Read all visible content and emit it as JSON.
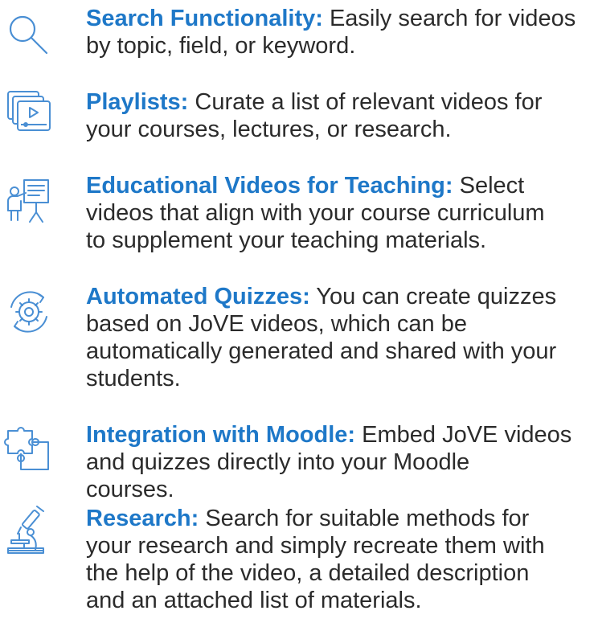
{
  "accent_color": "#1e78c8",
  "icon_color": "#4a8fd4",
  "text_color": "#2b2b2b",
  "features": [
    {
      "icon": "search-icon",
      "title": "Search Functionality:",
      "line1": "Easily search for videos",
      "lines": [
        "by topic, field, or keyword."
      ]
    },
    {
      "icon": "playlist-icon",
      "title": "Playlists:",
      "line1": "Curate a list of relevant videos for",
      "lines": [
        "your courses, lectures, or research."
      ]
    },
    {
      "icon": "teacher-presentation-icon",
      "title": "Educational Videos for Teaching:",
      "line1": "Select",
      "lines": [
        "videos that align with your course curriculum",
        "to supplement your teaching materials."
      ]
    },
    {
      "icon": "gear-cycle-icon",
      "title": "Automated Quizzes:",
      "line1": "You can create quizzes",
      "lines": [
        "based on JoVE videos, which can be",
        "automatically generated and shared with your",
        "students."
      ]
    },
    {
      "icon": "puzzle-icon",
      "title": "Integration with Moodle:",
      "line1": "Embed JoVE videos",
      "lines": [
        "and quizzes directly into your Moodle",
        "courses."
      ]
    },
    {
      "icon": "microscope-icon",
      "title": "Research:",
      "line1": "Search for suitable methods for",
      "lines": [
        "your research and simply recreate them with",
        "the help of the video, a detailed description",
        "and an attached list of materials."
      ]
    }
  ]
}
